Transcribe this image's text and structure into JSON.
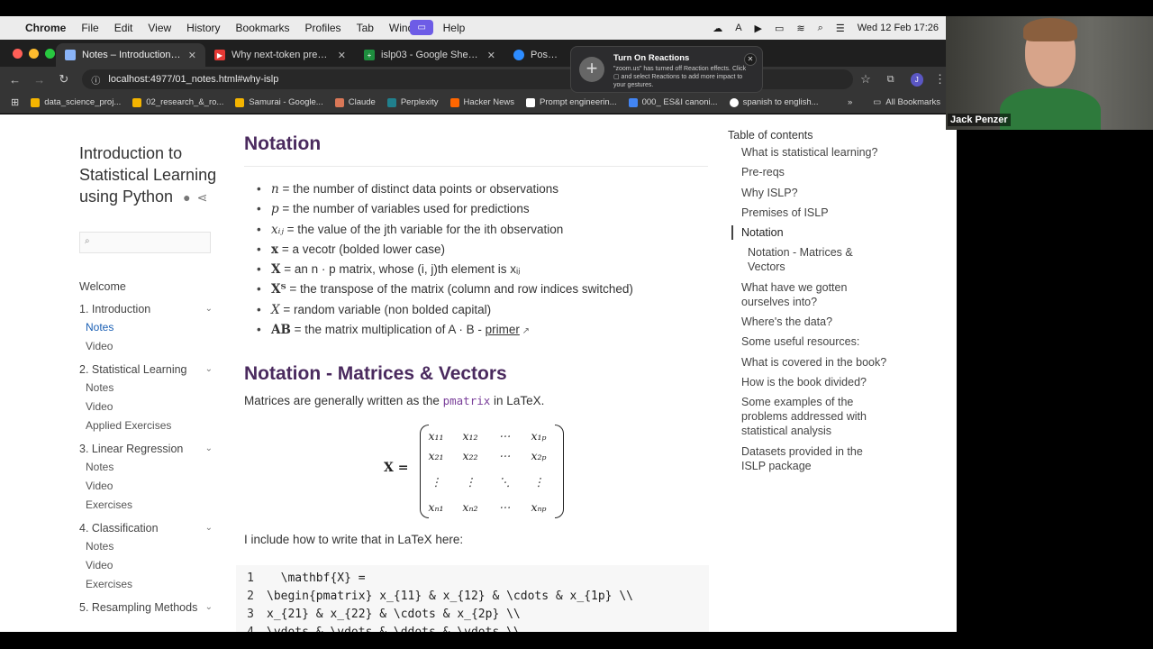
{
  "menubar": {
    "app": "Chrome",
    "items": [
      "File",
      "Edit",
      "View",
      "History",
      "Bookmarks",
      "Profiles",
      "Tab",
      "Window",
      "Help"
    ],
    "clock": "Wed 12 Feb  17:26"
  },
  "tabs": [
    {
      "label": "Notes – Introduction to Statis",
      "fav_color": "#8ab4f8",
      "active": true
    },
    {
      "label": "Why next-token prediction is",
      "fav_color": "#e53935",
      "active": false
    },
    {
      "label": "islp03 - Google Sheets",
      "fav_color": "#1e8e3e",
      "active": false
    },
    {
      "label": "Post Attend",
      "fav_color": "#2d8cff",
      "active": false
    }
  ],
  "address": {
    "url": "localhost:4977/01_notes.html#why-islp",
    "profile_initial": "J"
  },
  "bookmarks": [
    {
      "label": "data_science_proj...",
      "color": "#f4b400"
    },
    {
      "label": "02_research_&_ro...",
      "color": "#f4b400"
    },
    {
      "label": "Samurai - Google...",
      "color": "#f4b400"
    },
    {
      "label": "Claude",
      "color": "#d97757"
    },
    {
      "label": "Perplexity",
      "color": "#20808d"
    },
    {
      "label": "Hacker News",
      "color": "#ff6600"
    },
    {
      "label": "Prompt engineerin...",
      "color": "#ffffff"
    },
    {
      "label": "000_ ES&I canoni...",
      "color": "#4285f4"
    },
    {
      "label": "spanish to english...",
      "color": "#ffffff"
    }
  ],
  "bookmarks_all": "All Bookmarks",
  "popup": {
    "title": "Turn On Reactions",
    "body": "\"zoom.us\" has turned off Reaction effects. Click ▢ and select Reactions to add more impact to your gestures."
  },
  "sidebar": {
    "title": "Introduction to Statistical Learning using Python",
    "nav": [
      {
        "type": "top",
        "label": "Welcome"
      },
      {
        "type": "sec",
        "label": "1. Introduction"
      },
      {
        "type": "sub",
        "label": "Notes",
        "active": true
      },
      {
        "type": "sub",
        "label": "Video"
      },
      {
        "type": "sec",
        "label": "2. Statistical Learning"
      },
      {
        "type": "sub",
        "label": "Notes"
      },
      {
        "type": "sub",
        "label": "Video"
      },
      {
        "type": "sub",
        "label": "Applied Exercises"
      },
      {
        "type": "sec",
        "label": "3. Linear Regression"
      },
      {
        "type": "sub",
        "label": "Notes"
      },
      {
        "type": "sub",
        "label": "Video"
      },
      {
        "type": "sub",
        "label": "Exercises"
      },
      {
        "type": "sec",
        "label": "4. Classification"
      },
      {
        "type": "sub",
        "label": "Notes"
      },
      {
        "type": "sub",
        "label": "Video"
      },
      {
        "type": "sub",
        "label": "Exercises"
      },
      {
        "type": "sec",
        "label": "5. Resampling Methods"
      }
    ]
  },
  "content": {
    "h_notation": "Notation",
    "bullets": [
      {
        "sym": "n",
        "text": " = the number of distinct data points or observations"
      },
      {
        "sym": "p",
        "text": " = the number of variables used for predictions"
      },
      {
        "sym": "xᵢⱼ",
        "text": " = the value of the jth variable for the ith observation"
      },
      {
        "sym": "x",
        "bold": true,
        "text": " = a vecotr (bolded lower case)"
      },
      {
        "sym": "X",
        "bold": true,
        "text": " = an n · p matrix, whose (i, j)th element is xᵢⱼ"
      },
      {
        "sym": "Xᵀ",
        "bold": true,
        "text": " = the transpose of the matrix (column and row indices switched)"
      },
      {
        "sym": "X",
        "text": " = random variable (non bolded capital)"
      },
      {
        "sym": "AB",
        "bold": true,
        "text": " = the matrix multiplication of A · B - ",
        "link": "primer"
      }
    ],
    "h_matrices": "Notation - Matrices & Vectors",
    "para1_a": "Matrices are generally written as the ",
    "para1_code": "pmatrix",
    "para1_b": " in LaTeX.",
    "matrix": {
      "lhs": "X =",
      "cells": [
        [
          "x₁₁",
          "x₁₂",
          "⋯",
          "x₁ₚ"
        ],
        [
          "x₂₁",
          "x₂₂",
          "⋯",
          "x₂ₚ"
        ],
        [
          "⋮",
          "⋮",
          "⋱",
          "⋮"
        ],
        [
          "xₙ₁",
          "xₙ₂",
          "⋯",
          "xₙₚ"
        ]
      ]
    },
    "para2": "I include how to write that in LaTeX here:",
    "code": [
      {
        "n": "1",
        "text": "  \\mathbf{X} ="
      },
      {
        "n": "2",
        "text": "\\begin{pmatrix} x_{11} & x_{12} & \\cdots & x_{1p} \\\\"
      },
      {
        "n": "3",
        "text": "x_{21} & x_{22} & \\cdots & x_{2p} \\\\"
      },
      {
        "n": "4",
        "text": "\\vdots & \\vdots & \\ddots & \\vdots \\\\"
      }
    ]
  },
  "toc": {
    "title": "Table of contents",
    "items": [
      {
        "label": "What is statistical learning?"
      },
      {
        "label": "Pre-reqs"
      },
      {
        "label": "Why ISLP?"
      },
      {
        "label": "Premises of ISLP"
      },
      {
        "label": "Notation",
        "active": true
      },
      {
        "label": "Notation - Matrices & Vectors",
        "sub": true
      },
      {
        "label": "What have we gotten ourselves into?"
      },
      {
        "label": "Where's the data?"
      },
      {
        "label": "Some useful resources:"
      },
      {
        "label": "What is covered in the book?"
      },
      {
        "label": "How is the book divided?"
      },
      {
        "label": "Some examples of the problems addressed with statistical analysis"
      },
      {
        "label": "Datasets provided in the ISLP package"
      }
    ]
  },
  "webcam": {
    "name": "Jack Penzer"
  }
}
